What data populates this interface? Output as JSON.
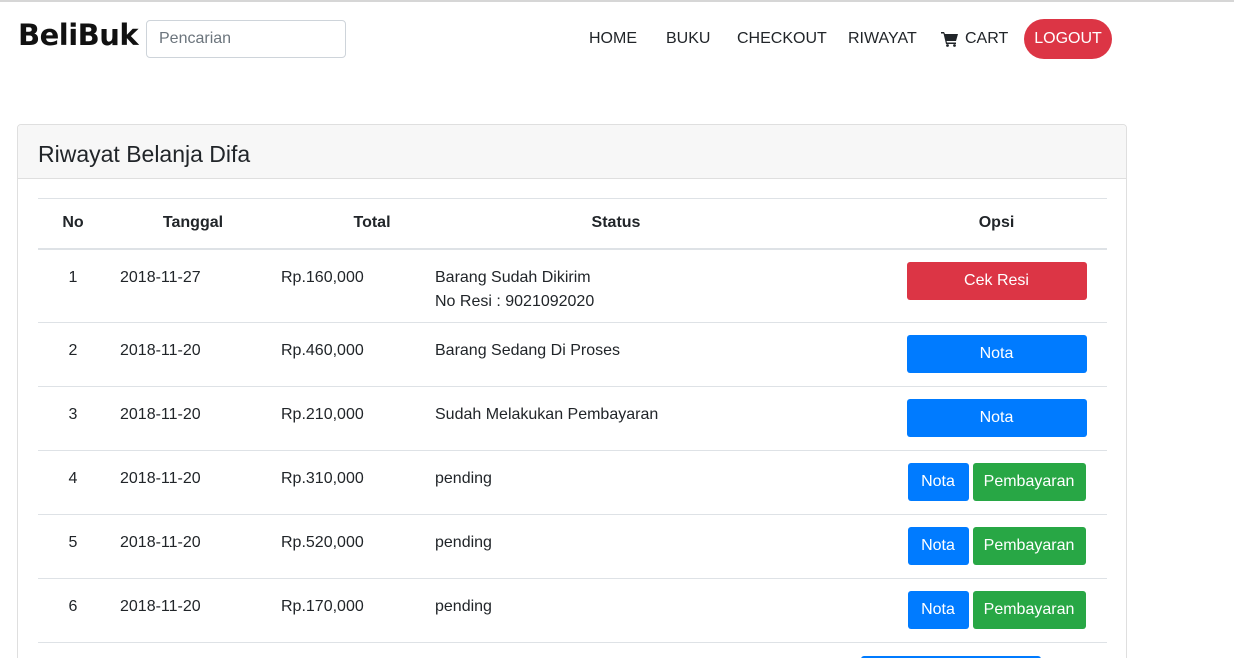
{
  "brand": "BeliBuk",
  "search": {
    "placeholder": "Pencarian"
  },
  "nav": {
    "home": "HOME",
    "buku": "BUKU",
    "checkout": "CHECKOUT",
    "riwayat": "RIWAYAT",
    "cart": "CART",
    "logout": "LOGOUT"
  },
  "card": {
    "title": "Riwayat Belanja Difa"
  },
  "table": {
    "headers": {
      "no": "No",
      "tanggal": "Tanggal",
      "total": "Total",
      "status": "Status",
      "opsi": "Opsi"
    },
    "rows": [
      {
        "no": "1",
        "tanggal": "2018-11-27",
        "total": "Rp.160,000",
        "status": "Barang Sudah Dikirim",
        "status2": "No Resi : 9021092020",
        "btn1": "Cek Resi"
      },
      {
        "no": "2",
        "tanggal": "2018-11-20",
        "total": "Rp.460,000",
        "status": "Barang Sedang Di Proses",
        "btn1": "Nota"
      },
      {
        "no": "3",
        "tanggal": "2018-11-20",
        "total": "Rp.210,000",
        "status": "Sudah Melakukan Pembayaran",
        "btn1": "Nota"
      },
      {
        "no": "4",
        "tanggal": "2018-11-20",
        "total": "Rp.310,000",
        "status": "pending",
        "btn1": "Nota",
        "btn2": "Pembayaran"
      },
      {
        "no": "5",
        "tanggal": "2018-11-20",
        "total": "Rp.520,000",
        "status": "pending",
        "btn1": "Nota",
        "btn2": "Pembayaran"
      },
      {
        "no": "6",
        "tanggal": "2018-11-20",
        "total": "Rp.170,000",
        "status": "pending",
        "btn1": "Nota",
        "btn2": "Pembayaran"
      }
    ]
  },
  "colors": {
    "danger": "#dc3545",
    "primary": "#007bff",
    "success": "#28a745"
  }
}
